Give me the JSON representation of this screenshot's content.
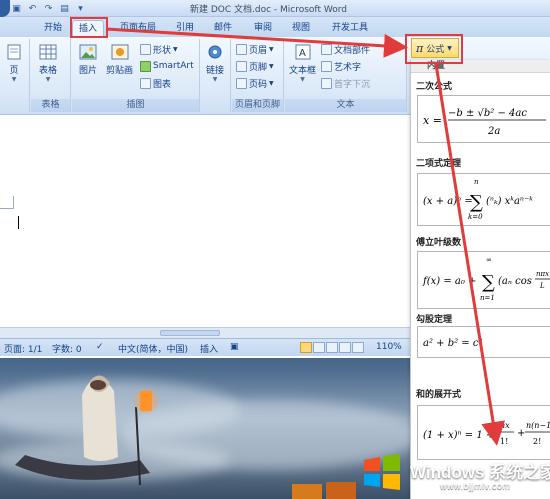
{
  "window": {
    "title": "新建 DOC 文档.doc - Microsoft Word"
  },
  "tabs": [
    "开始",
    "插入",
    "页面布局",
    "引用",
    "邮件",
    "审阅",
    "视图",
    "开发工具"
  ],
  "ribbon": {
    "page_group": {
      "label": "页"
    },
    "table_group": {
      "button": "表格",
      "label": "表格"
    },
    "illustrations_group": {
      "picture": "图片",
      "clipart": "剪贴画",
      "shapes": "形状",
      "smartart": "SmartArt",
      "chart": "图表",
      "label": "插图"
    },
    "links_group": {
      "button": "链接"
    },
    "header_footer_group": {
      "header": "页眉",
      "footer": "页脚",
      "page_number": "页码",
      "label": "页眉和页脚"
    },
    "text_group": {
      "textbox": "文本框",
      "quick_parts": "文档部件",
      "wordart": "艺术字",
      "dropcap": "首字下沉",
      "label": "文本"
    },
    "equation_button": "公式",
    "equation_symbol": "π"
  },
  "status_bar": {
    "page": "页面: 1/1",
    "words": "字数: 0",
    "language": "中文(简体，中国)",
    "mode": "插入",
    "zoom": "110%"
  },
  "gallery": {
    "header": "内置",
    "items": [
      {
        "title": "二次公式"
      },
      {
        "title": "二项式定理"
      },
      {
        "title": "傅立叶级数"
      },
      {
        "title": "勾股定理"
      },
      {
        "title": "和的展开式"
      }
    ]
  },
  "watermark": {
    "title": "Windows 系统之家",
    "url": "www.bjjmlv.com"
  },
  "colors": {
    "annotation_red": "#e13b3b",
    "ribbon_blue": "#15428b",
    "equation_highlight": "#ffd96a"
  }
}
